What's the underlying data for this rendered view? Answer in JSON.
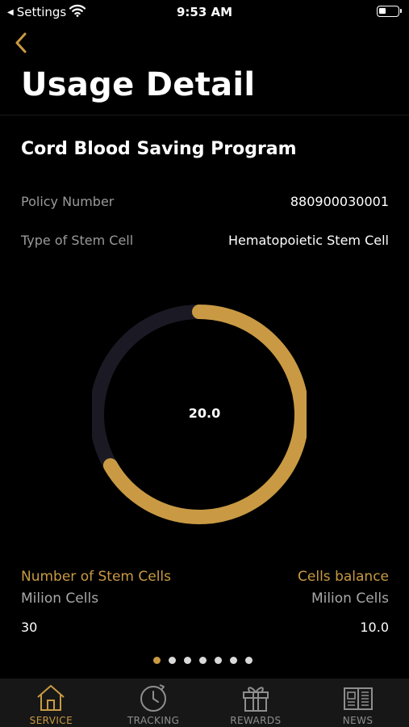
{
  "status_bar": {
    "back_label": "Settings",
    "time": "9:53 AM"
  },
  "header": {
    "title": "Usage Detail"
  },
  "program": {
    "title": "Cord Blood Saving Program",
    "rows": [
      {
        "label": "Policy Number",
        "value": "880900030001"
      },
      {
        "label": "Type of Stem Cell",
        "value": "Hematopoietic Stem Cell"
      }
    ]
  },
  "chart_data": {
    "type": "pie",
    "center_label": "20.0",
    "total": 30,
    "used_fraction": 0.6667,
    "remaining_fraction": 0.3333,
    "colors": {
      "used": "#c99a43",
      "remaining": "#1b1a24"
    }
  },
  "stats": {
    "left": {
      "title": "Number of Stem Cells",
      "unit": "Milion Cells",
      "value": "30"
    },
    "right": {
      "title": "Cells balance",
      "unit": "Milion Cells",
      "value": "10.0"
    }
  },
  "pager": {
    "count": 7,
    "active": 0
  },
  "tabs": [
    {
      "label": "SERVICE",
      "icon": "home-icon",
      "active": true
    },
    {
      "label": "TRACKING",
      "icon": "clock-icon",
      "active": false
    },
    {
      "label": "REWARDS",
      "icon": "gift-icon",
      "active": false
    },
    {
      "label": "NEWS",
      "icon": "news-icon",
      "active": false
    }
  ],
  "colors": {
    "accent": "#c99a43",
    "background": "#000000",
    "tab_bar": "#171717"
  }
}
